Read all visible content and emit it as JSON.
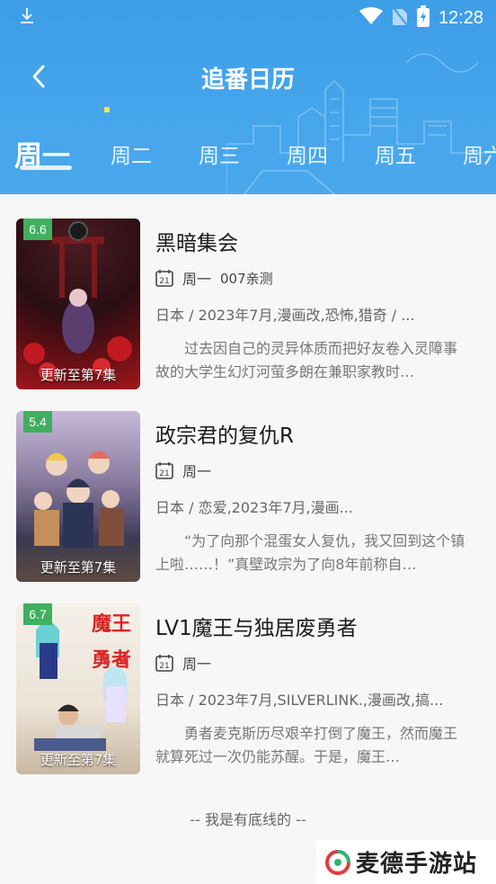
{
  "status": {
    "time": "12:28"
  },
  "header": {
    "title": "追番日历",
    "back_icon": "chevron-left-icon"
  },
  "tabs": [
    {
      "label": "周一",
      "active": true
    },
    {
      "label": "周二",
      "active": false
    },
    {
      "label": "周三",
      "active": false
    },
    {
      "label": "周四",
      "active": false
    },
    {
      "label": "周五",
      "active": false
    },
    {
      "label": "周六",
      "active": false
    }
  ],
  "items": [
    {
      "score": "6.6",
      "update": "更新至第7集",
      "title": "黑暗集会",
      "day": "周一",
      "note": "007亲测",
      "meta": "日本 / 2023年7月,漫画改,恐怖,猎奇 / ...",
      "desc": "过去因自己的灵异体质而把好友卷入灵障事故的大学生幻灯河萤多朗在兼职家教时…"
    },
    {
      "score": "5.4",
      "update": "更新至第7集",
      "title": "政宗君的复仇R",
      "day": "周一",
      "note": "",
      "meta": "日本 / 恋爱,2023年7月,漫画...",
      "desc": "“为了向那个混蛋女人复仇，我又回到这个镇上啦……！”真壁政宗为了向8年前称自…"
    },
    {
      "score": "6.7",
      "update": "更新至第7集",
      "title": "LV1魔王与独居废勇者",
      "day": "周一",
      "note": "",
      "meta": "日本 / 2023年7月,SILVERLINK.,漫画改,搞...",
      "desc": "勇者麦克斯历尽艰辛打倒了魔王，然而魔王就算死过一次仍能苏醒。于是，魔王…"
    }
  ],
  "footer": {
    "text": "-- 我是有底线的 --"
  },
  "watermark": {
    "text": "麦德手游站"
  },
  "colors": {
    "header": "#4aa8ec",
    "score_badge": "#3fb05f"
  }
}
